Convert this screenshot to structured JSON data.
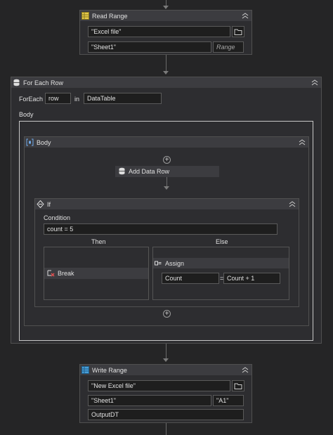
{
  "read_range": {
    "title": "Read Range",
    "file_value": "\"Excel file\"",
    "sheet_value": "\"Sheet1\"",
    "range_placeholder": "Range"
  },
  "for_each_row": {
    "title": "For Each Row",
    "foreach_label": "ForEach",
    "item_value": "row",
    "in_label": "in",
    "collection_value": "DataTable",
    "body_label": "Body"
  },
  "body_seq": {
    "title": "Body"
  },
  "add_data_row": {
    "title": "Add Data Row"
  },
  "if_activity": {
    "title": "If",
    "condition_label": "Condition",
    "condition_value": "count = 5",
    "then_label": "Then",
    "else_label": "Else"
  },
  "break_activity": {
    "title": "Break"
  },
  "assign": {
    "title": "Assign",
    "to_value": "Count",
    "equals": "=",
    "expr_value": "Count + 1"
  },
  "write_range": {
    "title": "Write Range",
    "file_value": "\"New Excel file\"",
    "sheet_value": "\"Sheet1\"",
    "cell_value": "\"A1\"",
    "datatable_value": "OutputDT"
  },
  "colors": {
    "canvas": "#252526",
    "activity": "#2d2d30",
    "header": "#3c3c40",
    "field": "#1e1e1e",
    "border": "#505050"
  }
}
